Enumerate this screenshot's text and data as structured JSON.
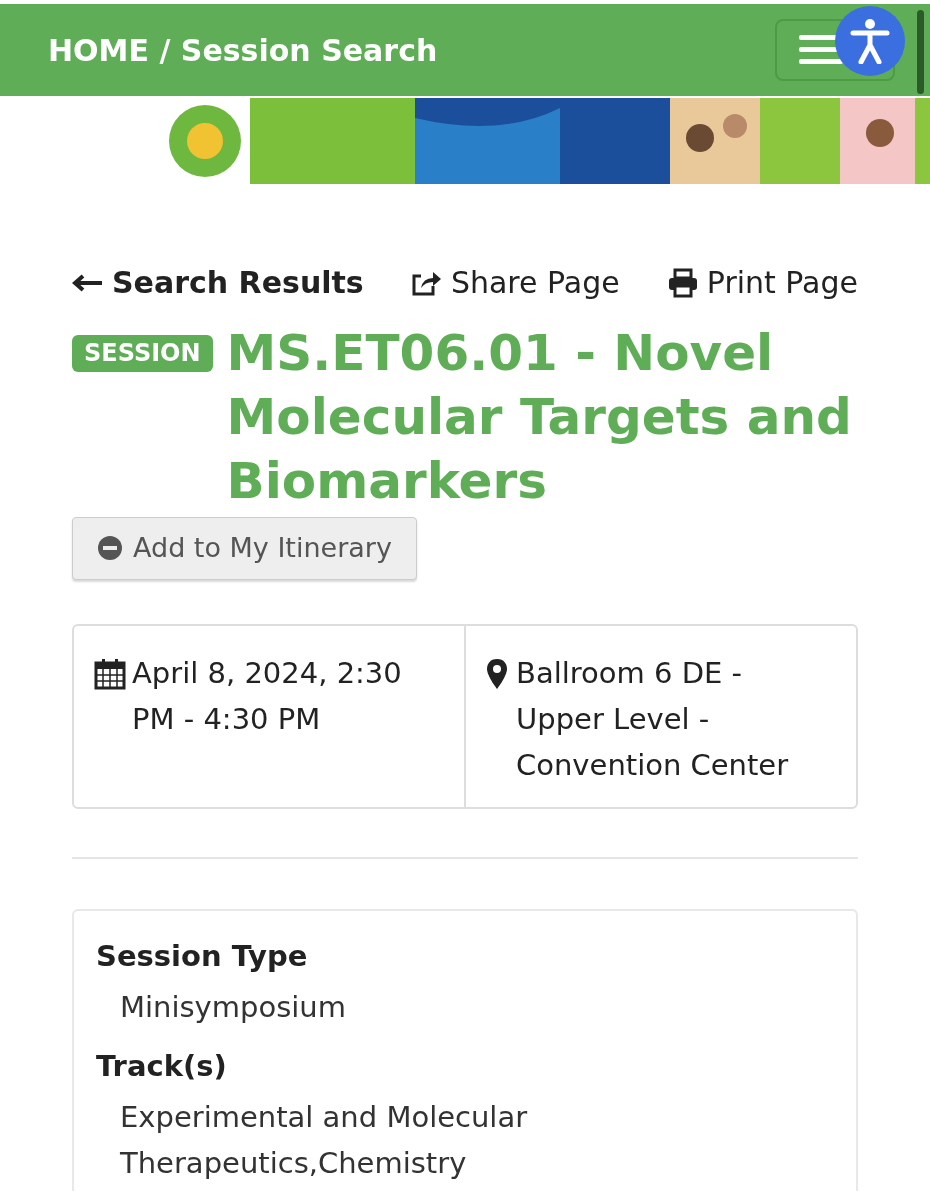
{
  "nav": {
    "breadcrumb": "HOME / Session Search"
  },
  "actions": [
    {
      "kind": "back",
      "label": "Search Results"
    },
    {
      "kind": "share",
      "label": "Share Page"
    },
    {
      "kind": "print",
      "label": "Print Page"
    }
  ],
  "session": {
    "badge": "SESSION",
    "title": "MS.ET06.01 - Novel Molecular Targets and Biomarkers",
    "itinerary_button": "Add to My Itinerary"
  },
  "details": [
    {
      "kind": "date",
      "text": "April 8, 2024, 2:30 PM - 4:30 PM"
    },
    {
      "kind": "location",
      "text": "Ballroom 6 DE - Upper Level - Convention Center"
    }
  ],
  "fields": [
    {
      "label": "Session Type",
      "value": "Minisymposium"
    },
    {
      "label": "Track(s)",
      "value": "Experimental and Molecular Therapeutics,Chemistry"
    }
  ]
}
